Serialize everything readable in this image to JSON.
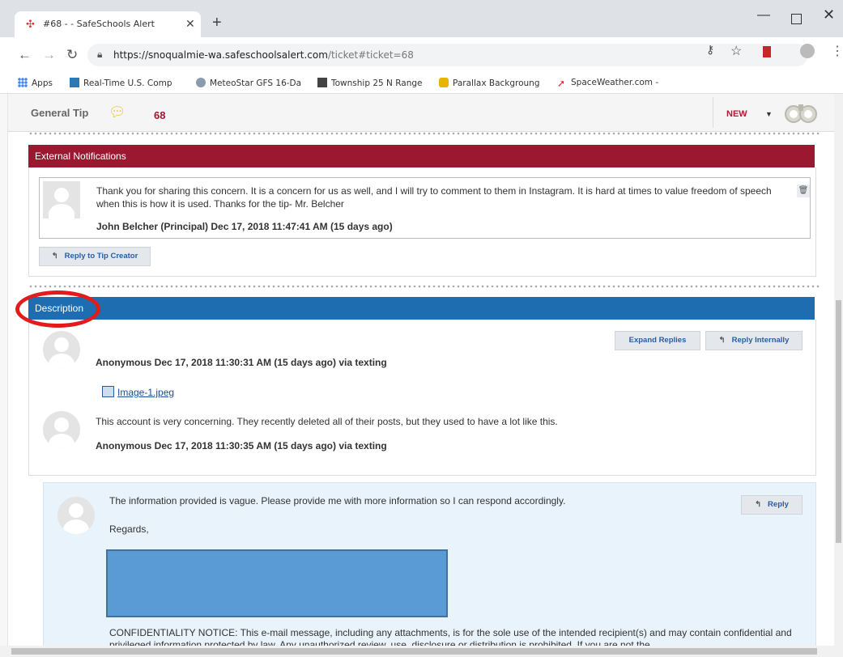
{
  "browser": {
    "tab_title": "#68 - - SafeSchools Alert",
    "url_base": "https://snoqualmie-wa.safeschoolsalert.com",
    "url_path": "/ticket#ticket=68",
    "bookmarks": [
      "Apps",
      "Real-Time U.S. Comp",
      "MeteoStar GFS 16-Da",
      "Township 25 N Range",
      "Parallax Backgroung",
      "SpaceWeather.com -"
    ]
  },
  "ticket": {
    "type": "General Tip",
    "number": "68",
    "status": "NEW"
  },
  "external": {
    "title": "External Notifications",
    "note_text": "Thank you for sharing this concern. It is a concern for us as well, and I will try to comment to them in Instagram. It is hard at times to value freedom of speech when this is how it is used. Thanks for the tip- Mr. Belcher",
    "note_author": "John Belcher (Principal) Dec 17, 2018 11:47:41 AM (15 days ago)",
    "reply_button": "Reply to Tip Creator"
  },
  "description": {
    "title": "Description",
    "expand_button": "Expand Replies",
    "reply_internally_button": "Reply Internally",
    "entry1_meta": "Anonymous Dec 17, 2018 11:30:31 AM (15 days ago) via texting",
    "attachment": "Image-1.jpeg",
    "entry2_text": "This account is very concerning. They recently deleted all of their posts, but they used to have a lot like this.",
    "entry2_meta": "Anonymous Dec 17, 2018 11:30:35 AM (15 days ago) via texting"
  },
  "reply": {
    "text": "The information provided is vague.  Please provide me with more information so I can respond accordingly.",
    "regards": "Regards,",
    "button": "Reply",
    "confidentiality": "CONFIDENTIALITY NOTICE: This e-mail message, including any attachments, is for the sole use of the intended recipient(s) and may contain confidential and privileged information protected by law. Any unauthorized review, use, disclosure or distribution is prohibited. If you are not the"
  },
  "colors": {
    "external_header": "#9b1830",
    "description_header": "#1d6db0",
    "reply_background": "#e8f3fb",
    "annotation": "#e31b1b"
  }
}
